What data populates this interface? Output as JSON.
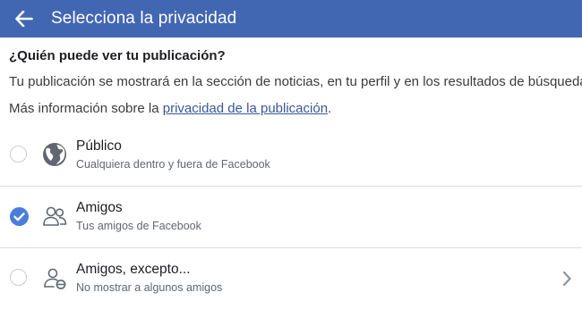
{
  "header": {
    "back_icon": "arrow-left-icon",
    "title": "Selecciona la privacidad",
    "bg_color": "#4267b2"
  },
  "intro": {
    "question": "¿Quién puede ver tu publicación?",
    "description": "Tu publicación se mostrará en la sección de noticias, en tu perfil y en los resultados de búsqueda.",
    "more_prefix": "Más información sobre la ",
    "more_link": "privacidad de la publicación",
    "more_suffix": "."
  },
  "options": [
    {
      "title": "Público",
      "subtitle": "Cualquiera dentro y fuera de Facebook",
      "icon": "globe-icon",
      "selected": false
    },
    {
      "title": "Amigos",
      "subtitle": "Tus amigos de Facebook",
      "icon": "friends-icon",
      "selected": true
    },
    {
      "title": "Amigos, excepto...",
      "subtitle": "No mostrar a algunos amigos",
      "icon": "friends-except-icon",
      "selected": false,
      "has_chevron": true
    }
  ],
  "colors": {
    "accent": "#4a7cdc",
    "link": "#385898"
  }
}
